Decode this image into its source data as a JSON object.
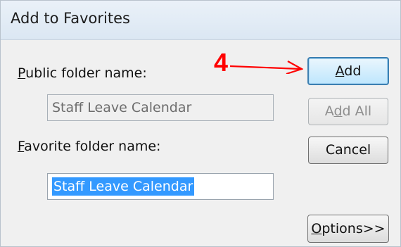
{
  "dialog": {
    "title": "Add to Favorites"
  },
  "labels": {
    "public_folder_name": {
      "before": "",
      "mnemonic": "P",
      "after": "ublic folder name:"
    },
    "favorite_folder_name": {
      "before": "",
      "mnemonic": "F",
      "after": "avorite folder name:"
    }
  },
  "fields": {
    "public_folder_value": "Staff Leave Calendar",
    "favorite_folder_value": "Staff Leave Calendar"
  },
  "buttons": {
    "add": {
      "before": "",
      "mnemonic": "A",
      "after": "dd"
    },
    "add_all": {
      "before": "A",
      "mnemonic": "d",
      "after": "d All"
    },
    "cancel": "Cancel",
    "options": {
      "before": "",
      "mnemonic": "O",
      "after": "ptions>>"
    }
  },
  "annotation": {
    "step_number": "4",
    "color": "#ff0000"
  }
}
